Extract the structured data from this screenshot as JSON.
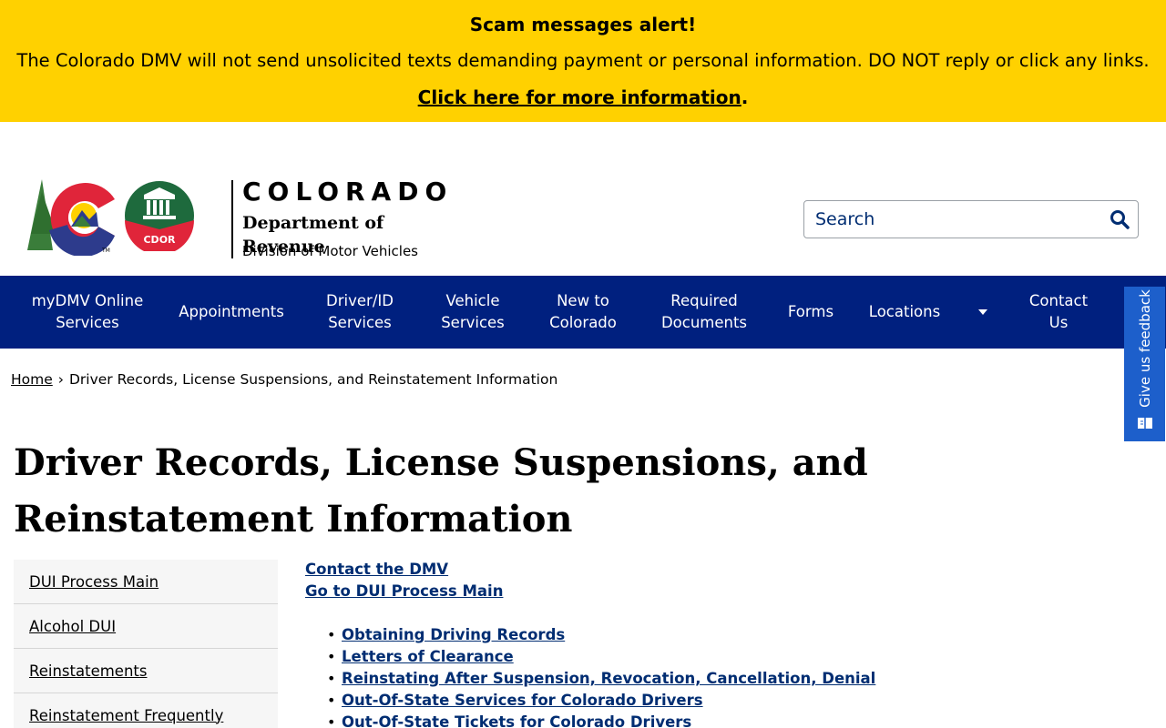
{
  "alert": {
    "title": "Scam messages alert!",
    "text": "The Colorado DMV will not send unsolicited texts demanding payment or personal information. DO NOT reply or click any links.",
    "link_label": "Click here for more information",
    "link_suffix": "."
  },
  "header": {
    "state": "COLORADO",
    "department": "Department of Revenue",
    "division": "Division of Motor Vehicles",
    "seal_text": "CDOR",
    "tm": "TM"
  },
  "search": {
    "placeholder": "Search"
  },
  "nav": {
    "items": [
      {
        "label": "myDMV Online Services"
      },
      {
        "label": "Appointments"
      },
      {
        "label": "Driver/ID Services"
      },
      {
        "label": "Vehicle Services"
      },
      {
        "label": "New to Colorado"
      },
      {
        "label": "Required Documents"
      },
      {
        "label": "Forms"
      },
      {
        "label": "Locations"
      },
      {
        "label": "Contact Us"
      }
    ]
  },
  "feedback": {
    "label": "Give us feedback"
  },
  "breadcrumb": {
    "home": "Home",
    "separator": "›",
    "current": "Driver Records, License Suspensions, and Reinstatement Information"
  },
  "page": {
    "title": "Driver Records, License Suspensions, and Reinstatement Information"
  },
  "sidebar": {
    "items": [
      {
        "label": "DUI Process Main"
      },
      {
        "label": "Alcohol DUI"
      },
      {
        "label": "Reinstatements"
      },
      {
        "label": "Reinstatement Frequently"
      }
    ]
  },
  "content": {
    "top_links": [
      {
        "label": "Contact the DMV"
      },
      {
        "label": "Go to DUI Process Main"
      }
    ],
    "topics": [
      {
        "label": "Obtaining Driving Records"
      },
      {
        "label": "Letters of Clearance"
      },
      {
        "label": "Reinstating After Suspension, Revocation, Cancellation, Denial"
      },
      {
        "label": "Out-Of-State Services for Colorado Drivers"
      },
      {
        "label": "Out-Of-State Tickets for Colorado Drivers"
      }
    ]
  },
  "colors": {
    "alert_bg": "#ffd100",
    "nav_bg": "#00207f",
    "link": "#002d72",
    "feedback_bg": "#1d5fcb"
  }
}
